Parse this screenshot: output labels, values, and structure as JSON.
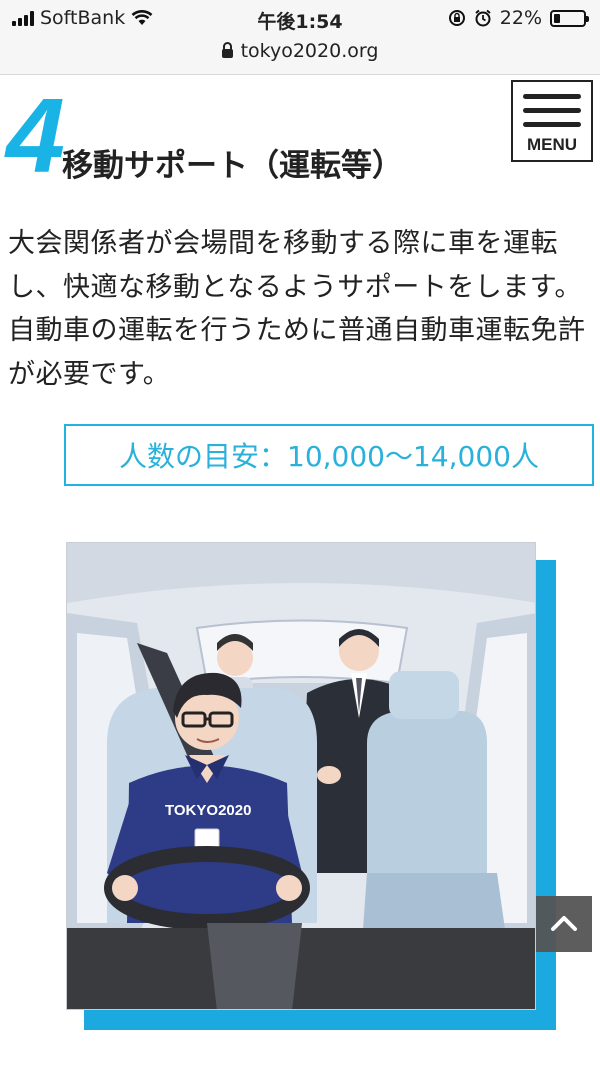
{
  "status_bar": {
    "carrier": "SoftBank",
    "time": "午後1:54",
    "battery": "22%",
    "battery_level": 0.22,
    "url": "tokyo2020.org",
    "icons": [
      "signal-icon",
      "wifi-icon",
      "rotation-lock-icon",
      "alarm-icon",
      "battery-icon",
      "lock-icon"
    ]
  },
  "header": {
    "menu_label": "MENU"
  },
  "section": {
    "number": "4",
    "title": "移動サポート（運転等）",
    "description": "大会関係者が会場間を移動する際に車を運転し、快適な移動となるようサポートをします。自動車の運転を行うために普通自動車運転免許が必要です。",
    "count_label": "人数の目安：10,000〜14,000人"
  },
  "illustration": {
    "shirt_text": "TOKYO2020"
  },
  "colors": {
    "accent": "#19b3e6",
    "box_border": "#22b3e0",
    "shadow_block": "#1ba9e0",
    "scroll_button": "#555555"
  }
}
